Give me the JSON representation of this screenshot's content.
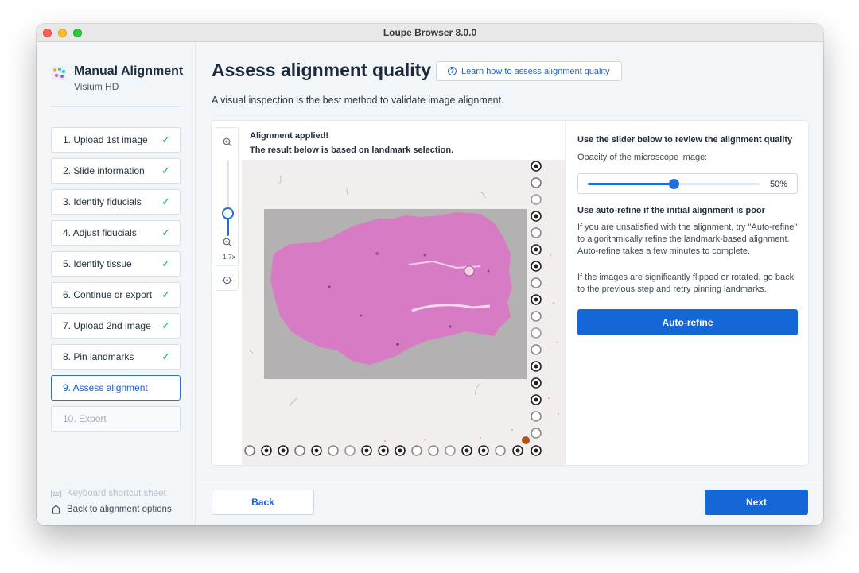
{
  "window": {
    "title": "Loupe Browser 8.0.0"
  },
  "sidebar": {
    "title": "Manual Alignment",
    "subtitle": "Visium HD",
    "steps": [
      {
        "label": "1. Upload 1st image",
        "state": "done"
      },
      {
        "label": "2. Slide information",
        "state": "done"
      },
      {
        "label": "3. Identify fiducials",
        "state": "done"
      },
      {
        "label": "4. Adjust fiducials",
        "state": "done"
      },
      {
        "label": "5. Identify tissue",
        "state": "done"
      },
      {
        "label": "6. Continue or export",
        "state": "done"
      },
      {
        "label": "7. Upload 2nd image",
        "state": "done"
      },
      {
        "label": "8. Pin landmarks",
        "state": "done"
      },
      {
        "label": "9. Assess alignment",
        "state": "active"
      },
      {
        "label": "10. Export",
        "state": "disabled"
      }
    ],
    "check_glyph": "✓",
    "keyboard_shortcut": "Keyboard shortcut sheet",
    "back_to_options": "Back to alignment options"
  },
  "main": {
    "title": "Assess alignment quality",
    "learn_button": "Learn how to assess alignment quality",
    "intro": "A visual inspection is the best method to validate image alignment.",
    "viewer": {
      "applied_line1": "Alignment applied!",
      "applied_line2": "The result below is based on landmark selection.",
      "zoom_level": "-1.7x",
      "zoom_slider_fraction": 0.3
    },
    "review": {
      "heading": "Use the slider below to review the alignment quality",
      "opacity_label": "Opacity of the microscope image:",
      "opacity_value": "50%",
      "opacity_fraction": 0.5,
      "refine_heading": "Use auto-refine if the initial alignment is poor",
      "refine_p1": "If you are unsatisfied with the alignment, try \"Auto-refine\" to algorithmically refine the landmark-based alignment. Auto-refine takes a few minutes to complete.",
      "refine_p2": "If the images are significantly flipped or rotated, go back to the previous step and retry pinning landmarks.",
      "autorefine_button": "Auto-refine"
    }
  },
  "footer": {
    "back": "Back",
    "next": "Next"
  },
  "colors": {
    "accent": "#1566d6",
    "check": "#14a88b",
    "tissue": "#d77bc4"
  }
}
